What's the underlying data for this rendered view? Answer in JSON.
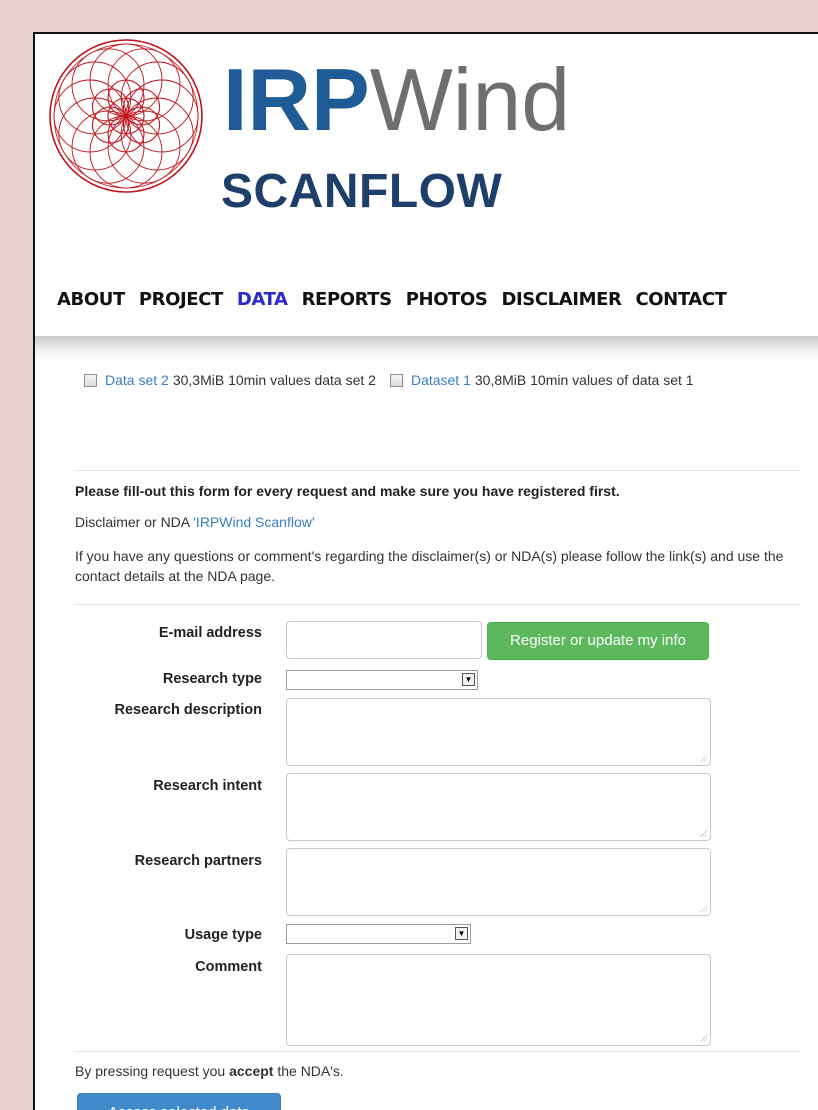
{
  "brand": {
    "title_bold": "IRP",
    "title_light": "Wind",
    "subtitle": "SCANFLOW",
    "logo_icon": "flower-of-life-logo-icon"
  },
  "nav": {
    "items": [
      "ABOUT",
      "PROJECT",
      "DATA",
      "REPORTS",
      "PHOTOS",
      "DISCLAIMER",
      "CONTACT"
    ],
    "active": "DATA"
  },
  "datasets": [
    {
      "link": "Data set 2",
      "desc": "30,3MiB 10min values data set 2",
      "checked": false
    },
    {
      "link": "Dataset 1",
      "desc": "30,8MiB 10min values of data set 1",
      "checked": false
    }
  ],
  "info": {
    "notice": "Please fill-out this form for every request and make sure you have registered first.",
    "disclaimer_prefix": "Disclaimer or NDA ",
    "disclaimer_link": "'IRPWind Scanflow'",
    "questions": "If you have any questions or comment's regarding the disclaimer(s) or NDA(s) please follow the link(s) and use the contact details at the NDA page."
  },
  "form": {
    "email_label": "E-mail address",
    "email_value": "",
    "register_button": "Register or update my info",
    "research_type_label": "Research type",
    "research_type_value": "",
    "research_description_label": "Research description",
    "research_intent_label": "Research intent",
    "research_partners_label": "Research partners",
    "usage_type_label": "Usage type",
    "usage_type_value": "",
    "comment_label": "Comment"
  },
  "footer": {
    "accept_prefix": "By pressing request you ",
    "accept_bold": "accept",
    "accept_suffix": " the NDA's.",
    "request_button": "Access selected data"
  },
  "colors": {
    "background": "#e8d0d0",
    "brand_blue": "#1e5b97",
    "nav_active": "#2a2ac9",
    "link": "#3a7ec2",
    "register_green": "#5cb85c",
    "request_blue": "#428bca",
    "logo_red": "#c0141a"
  }
}
